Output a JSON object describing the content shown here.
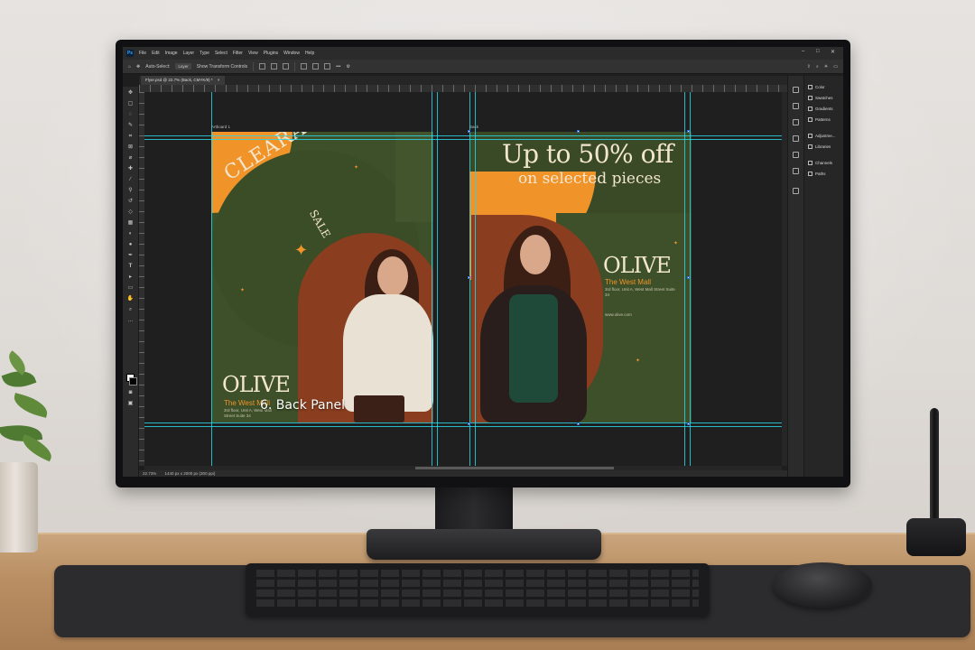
{
  "app": {
    "logo": "Ps"
  },
  "menu": [
    "File",
    "Edit",
    "Image",
    "Layer",
    "Type",
    "Select",
    "Filter",
    "View",
    "Plugins",
    "Window",
    "Help"
  ],
  "options_bar": {
    "auto_select_label": "Auto-Select:",
    "auto_select_value": "Layer",
    "transform_label": "Show Transform Controls",
    "more": "•••"
  },
  "document_tab": {
    "title": "Flyer.psd @ 22.7% (Back, CMYK/8) *",
    "close": "×"
  },
  "artboards": [
    {
      "label": "Artboard 1"
    },
    {
      "label": "Back"
    }
  ],
  "front_panel": {
    "clearance": "CLEARANCE",
    "sale": "SALE",
    "brand": "OLIVE",
    "store": "The West Mall",
    "address": "3rd floor, Unit A, West Mall Street Suite 34"
  },
  "back_panel": {
    "headline": "Up to 50% off",
    "subheadline": "on selected pieces",
    "brand": "OLIVE",
    "store": "The West Mall",
    "address": "3rd floor, Unit A, West Mall Street Suite 34",
    "website": "www.olive.com"
  },
  "right_panels": [
    {
      "label": "Color",
      "icon": "color-icon"
    },
    {
      "label": "Swatches",
      "icon": "swatches-icon"
    },
    {
      "label": "Gradients",
      "icon": "gradients-icon"
    },
    {
      "label": "Patterns",
      "icon": "patterns-icon"
    },
    {
      "label": "Adjustme...",
      "icon": "adjustments-icon"
    },
    {
      "label": "Libraries",
      "icon": "libraries-icon"
    },
    {
      "label": "Channels",
      "icon": "channels-icon"
    },
    {
      "label": "Paths",
      "icon": "paths-icon"
    }
  ],
  "status": {
    "zoom": "22.73%",
    "doc_info": "1440 px x 2000 px (300 ppi)"
  },
  "overlay_label": "6. Back Panel",
  "colors": {
    "accent_orange": "#f0942a",
    "olive_green": "#3a4a27",
    "guide_cyan": "#2bd3e6",
    "cream": "#f3e6cf"
  }
}
